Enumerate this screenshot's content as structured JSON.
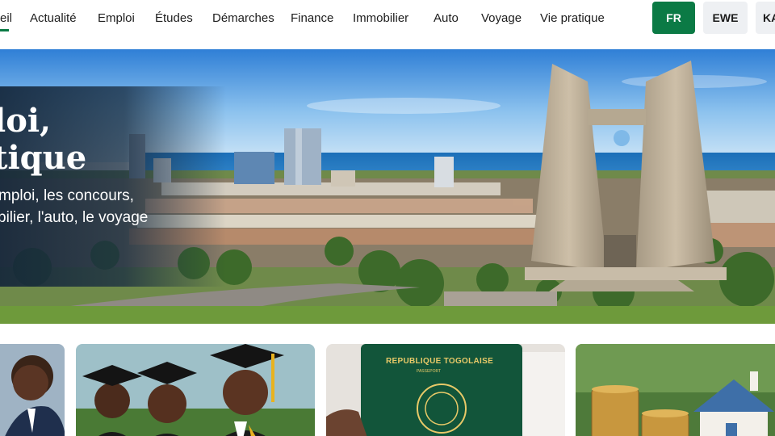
{
  "nav": {
    "items": [
      {
        "label": "eil",
        "active": true
      },
      {
        "label": "Actualité"
      },
      {
        "label": "Emploi"
      },
      {
        "label": "Études"
      },
      {
        "label": "Démarches"
      },
      {
        "label": "Finance"
      },
      {
        "label": "Immobilier"
      },
      {
        "label": "Auto"
      },
      {
        "label": "Voyage"
      },
      {
        "label": "Vie pratique"
      }
    ],
    "languages": [
      {
        "label": "FR",
        "selected": true
      },
      {
        "label": "EWE"
      },
      {
        "label": "KA"
      }
    ]
  },
  "hero": {
    "title_line1": "loi,",
    "title_line2": "tique",
    "subtitle_line1": "mploi, les concours,",
    "subtitle_line2": "bilier, l'auto, le voyage"
  },
  "cards": {
    "passport_title": "REPUBLIQUE TOGOLAISE",
    "passport_sub": "PASSEPORT"
  },
  "colors": {
    "brand_green": "#0b7a45",
    "lang_inactive": "#eef0f3",
    "passport_green": "#12553a",
    "gold": "#e8c968"
  }
}
